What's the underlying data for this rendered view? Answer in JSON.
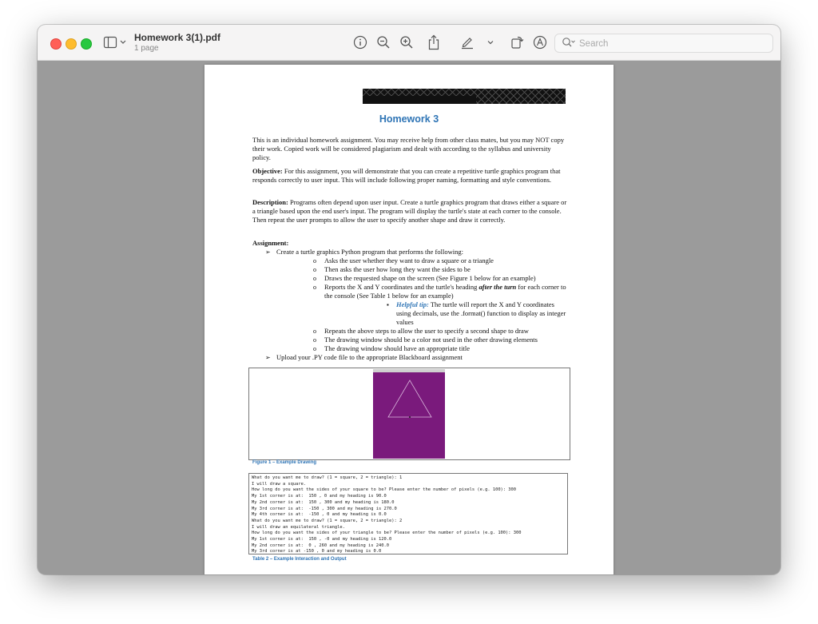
{
  "window": {
    "title": "Homework 3(1).pdf",
    "subtitle": "1 page"
  },
  "toolbar": {
    "icons": [
      "info-icon",
      "zoom-out-icon",
      "zoom-in-icon",
      "share-icon",
      "markup-pen-icon",
      "rotate-icon",
      "annotate-icon"
    ],
    "search_placeholder": "Search"
  },
  "document": {
    "title": "Homework 3",
    "intro": "This is an individual homework assignment.  You may receive help from other class mates, but you may NOT copy their work.  Copied work will be considered plagiarism and dealt with according to the syllabus and university policy.",
    "objective_label": "Objective:",
    "objective_text": " For this assignment, you will demonstrate that you can create a repetitive turtle graphics program that responds correctly to user input. This will include following proper naming, formatting and style conventions.",
    "description_label": "Description:",
    "description_text": " Programs often depend upon user input. Create a turtle graphics program that draws either a square or a triangle based upon the end user's input. The program will display the turtle's state at each corner to the console. Then repeat the user prompts to allow the user to specify another shape and draw it correctly.",
    "assignment_label": "Assignment:",
    "bullet_create": "Create a turtle graphics Python program that performs the following:",
    "sub_asks_shape": "Asks the user whether they want to draw a square or a triangle",
    "sub_asks_sides": "Then asks the user how long they want the sides to be",
    "sub_draws": "Draws the requested shape on the screen (See Figure 1 below for an example)",
    "sub_reports_a": "Reports the X and Y coordinates and the turtle's heading ",
    "sub_reports_emph": "after the turn",
    "sub_reports_b": " for each corner to the console (See Table 1 below for an example)",
    "tip_label": "Helpful tip:",
    "tip_text": " The turtle will report the X and Y coordinates using decimals, use the .format() function to display as integer values",
    "sub_repeats": "Repeats the above steps to allow the user to specify a second shape to draw",
    "sub_color": "The drawing window should be a color not used in the other drawing elements",
    "sub_title": "The drawing window should have an appropriate title",
    "bullet_upload": "Upload your .PY code file to the appropriate Blackboard assignment",
    "figure_caption": "Figure 1 – Example Drawing",
    "figure_window_color": "#7a1a7c",
    "table_caption": "Table 2 – Example Interaction and Output",
    "console_lines": [
      "What do you want me to draw? (1 = square, 2 = triangle): 1",
      "I will draw a square.",
      "How long do you want the sides of your square to be? Please enter the number of pixels (e.g. 100): 300",
      "My 1st corner is at:  150 , 0 and my heading is 90.0",
      "My 2nd corner is at:  150 , 300 and my heading is 180.0",
      "My 3rd corner is at:  -150 , 300 and my heading is 270.0",
      "My 4th corner is at:  -150 , 0 and my heading is 0.0",
      "What do you want me to draw? (1 = square, 2 = triangle): 2",
      "I will draw an equilateral triangle.",
      "How long do you want the sides of your triangle to be? Please enter the number of pixels (e.g. 100): 300",
      "My 1st corner is at:  150 , -0 and my heading is 120.0",
      "My 2nd corner is at:  0 , 260 and my heading is 240.0",
      "My 3rd corner is at -150 , 0 and my heading is 0.0"
    ]
  }
}
